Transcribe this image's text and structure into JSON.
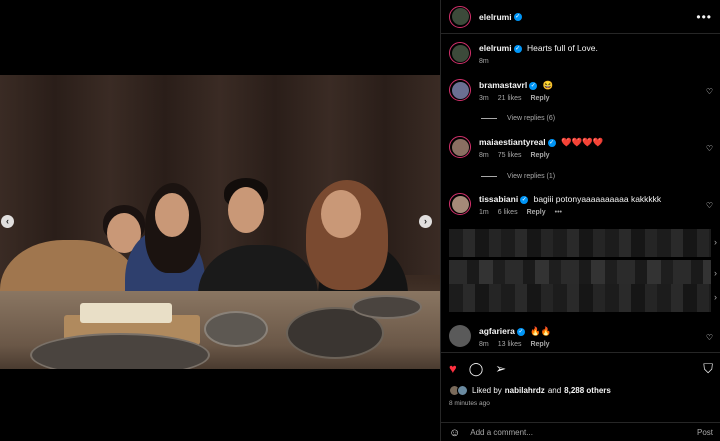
{
  "post": {
    "author": "elelrumi",
    "caption": "Hearts full of Love.",
    "caption_age": "8m"
  },
  "comments": [
    {
      "user": "bramastavrl",
      "text": "😆",
      "age": "3m",
      "likes": "21 likes",
      "reply": "Reply",
      "view_replies": "View replies (6)"
    },
    {
      "user": "maiaestiantyreal",
      "text": "❤️❤️❤️❤️",
      "age": "8m",
      "likes": "75 likes",
      "reply": "Reply",
      "view_replies": "View replies (1)"
    },
    {
      "user": "tissabiani",
      "text": "bagiii potonyaaaaaaaaaa kakkkkk",
      "age": "1m",
      "likes": "6 likes",
      "reply": "Reply",
      "more": "•••"
    },
    {
      "user": "agfariera",
      "text": "🔥🔥",
      "age": "8m",
      "likes": "13 likes",
      "reply": "Reply"
    }
  ],
  "likes": {
    "liked_by_prefix": "Liked by",
    "liked_by_user": "nabilahrdz",
    "conjunction": "and",
    "others": "8,288 others"
  },
  "timestamp": "8 minutes ago",
  "composer": {
    "placeholder": "Add a comment...",
    "post_label": "Post"
  },
  "icons": {
    "like": "heart-icon",
    "comment": "comment-icon",
    "share": "send-icon",
    "save": "bookmark-icon",
    "more": "more-icon",
    "emoji": "emoji-icon"
  },
  "colors": {
    "background": "#000000",
    "verified": "#0095f6",
    "liked_heart": "#ff3040",
    "muted_text": "#a8a8a8"
  }
}
